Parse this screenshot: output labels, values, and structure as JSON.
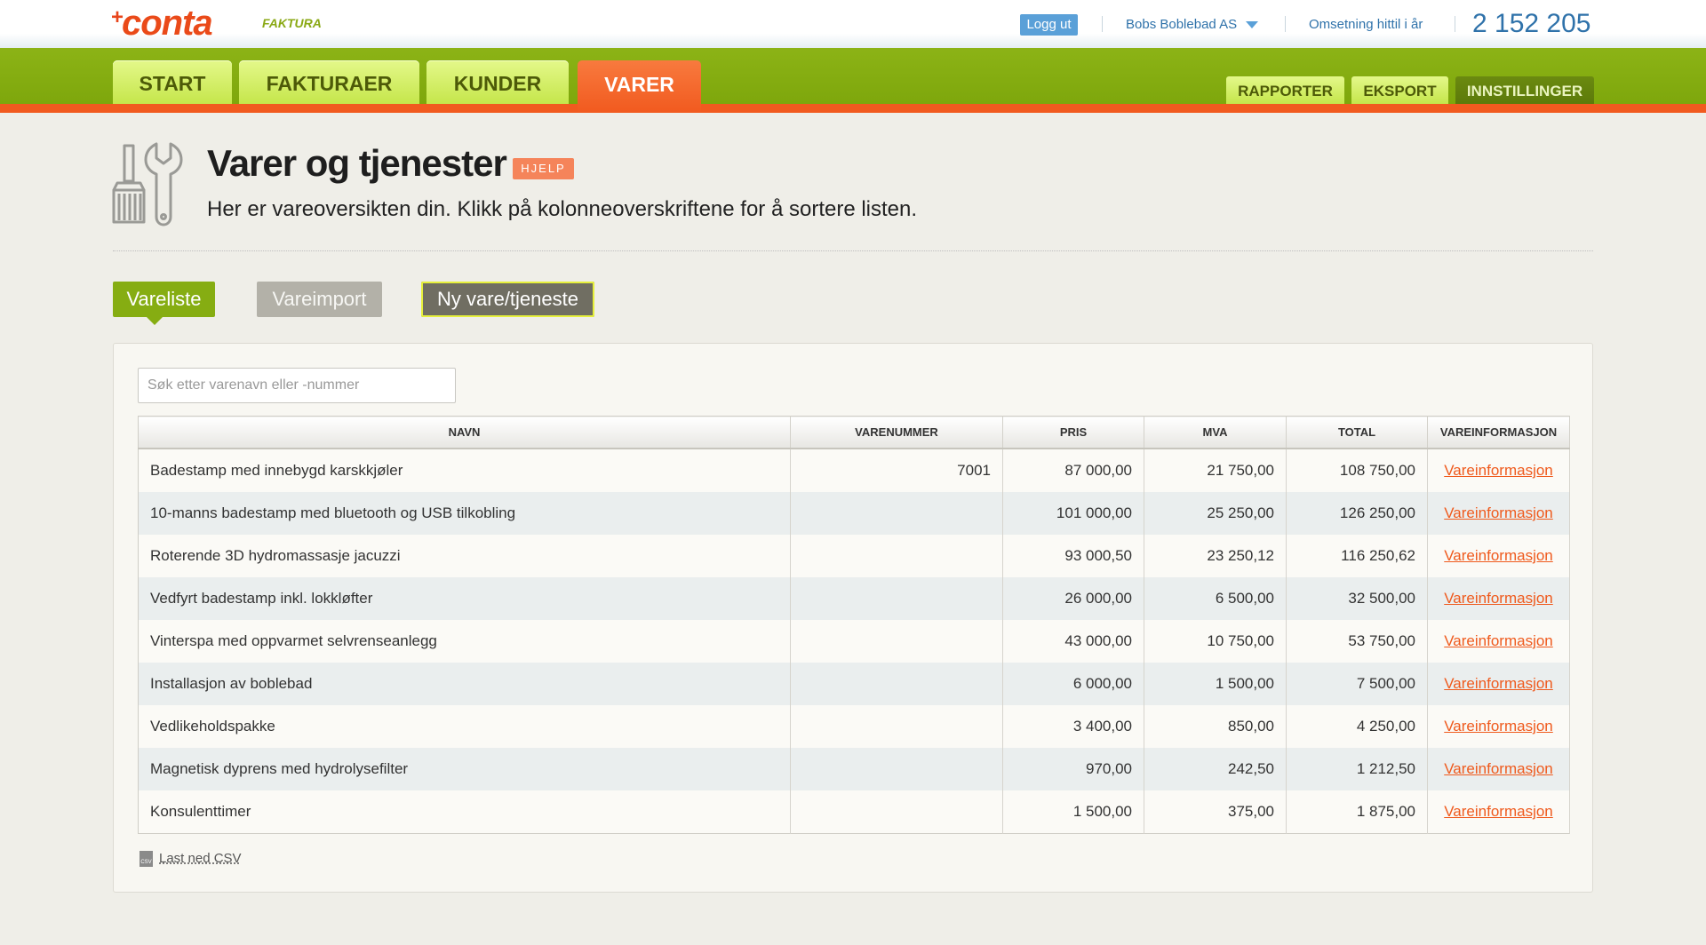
{
  "header": {
    "logo_prefix": "+",
    "logo_word": "conta",
    "logo_sub": "FAKTURA",
    "logout_label": "Logg ut",
    "company_name": "Bobs Boblebad AS",
    "turnover_label": "Omsetning hittil i år",
    "turnover_value": "2 152 205"
  },
  "nav": {
    "tabs": [
      {
        "label": "START"
      },
      {
        "label": "FAKTURAER"
      },
      {
        "label": "KUNDER"
      },
      {
        "label": "VARER",
        "active": true
      }
    ],
    "secondary": [
      {
        "label": "RAPPORTER"
      },
      {
        "label": "EKSPORT"
      },
      {
        "label": "INNSTILLINGER"
      }
    ]
  },
  "page": {
    "icon": "tools-icon",
    "title": "Varer og tjenester",
    "help_label": "HJELP",
    "subtitle": "Her er vareoversikten din. Klikk på kolonneoverskriftene for å sortere listen."
  },
  "view_buttons": {
    "list": "Vareliste",
    "import": "Vareimport",
    "new": "Ny vare/tjeneste"
  },
  "search": {
    "placeholder": "Søk etter varenavn eller -nummer",
    "value": ""
  },
  "table": {
    "columns": [
      "NAVN",
      "VARENUMMER",
      "PRIS",
      "MVA",
      "TOTAL",
      "VAREINFORMASJON"
    ],
    "rows": [
      {
        "name": "Badestamp med innebygd karskkjøler",
        "number": "7001",
        "price": "87 000,00",
        "vat": "21 750,00",
        "total": "108 750,00",
        "info": "Vareinformasjon"
      },
      {
        "name": "10-manns badestamp med bluetooth og USB tilkobling",
        "number": "",
        "price": "101 000,00",
        "vat": "25 250,00",
        "total": "126 250,00",
        "info": "Vareinformasjon"
      },
      {
        "name": "Roterende 3D hydromassasje jacuzzi",
        "number": "",
        "price": "93 000,50",
        "vat": "23 250,12",
        "total": "116 250,62",
        "info": "Vareinformasjon"
      },
      {
        "name": "Vedfyrt badestamp inkl. lokkløfter",
        "number": "",
        "price": "26 000,00",
        "vat": "6 500,00",
        "total": "32 500,00",
        "info": "Vareinformasjon"
      },
      {
        "name": "Vinterspa med oppvarmet selvrenseanlegg",
        "number": "",
        "price": "43 000,00",
        "vat": "10 750,00",
        "total": "53 750,00",
        "info": "Vareinformasjon"
      },
      {
        "name": "Installasjon av boblebad",
        "number": "",
        "price": "6 000,00",
        "vat": "1 500,00",
        "total": "7 500,00",
        "info": "Vareinformasjon"
      },
      {
        "name": "Vedlikeholdspakke",
        "number": "",
        "price": "3 400,00",
        "vat": "850,00",
        "total": "4 250,00",
        "info": "Vareinformasjon"
      },
      {
        "name": "Magnetisk dyprens med hydrolysefilter",
        "number": "",
        "price": "970,00",
        "vat": "242,50",
        "total": "1 212,50",
        "info": "Vareinformasjon"
      },
      {
        "name": "Konsulenttimer",
        "number": "",
        "price": "1 500,00",
        "vat": "375,00",
        "total": "1 875,00",
        "info": "Vareinformasjon"
      }
    ]
  },
  "footer": {
    "csv_icon_text": "CSV",
    "csv_label": "Last ned CSV"
  },
  "colors": {
    "brand_orange": "#f15a1f",
    "nav_green": "#86ad12",
    "link_blue": "#2f72aa"
  }
}
